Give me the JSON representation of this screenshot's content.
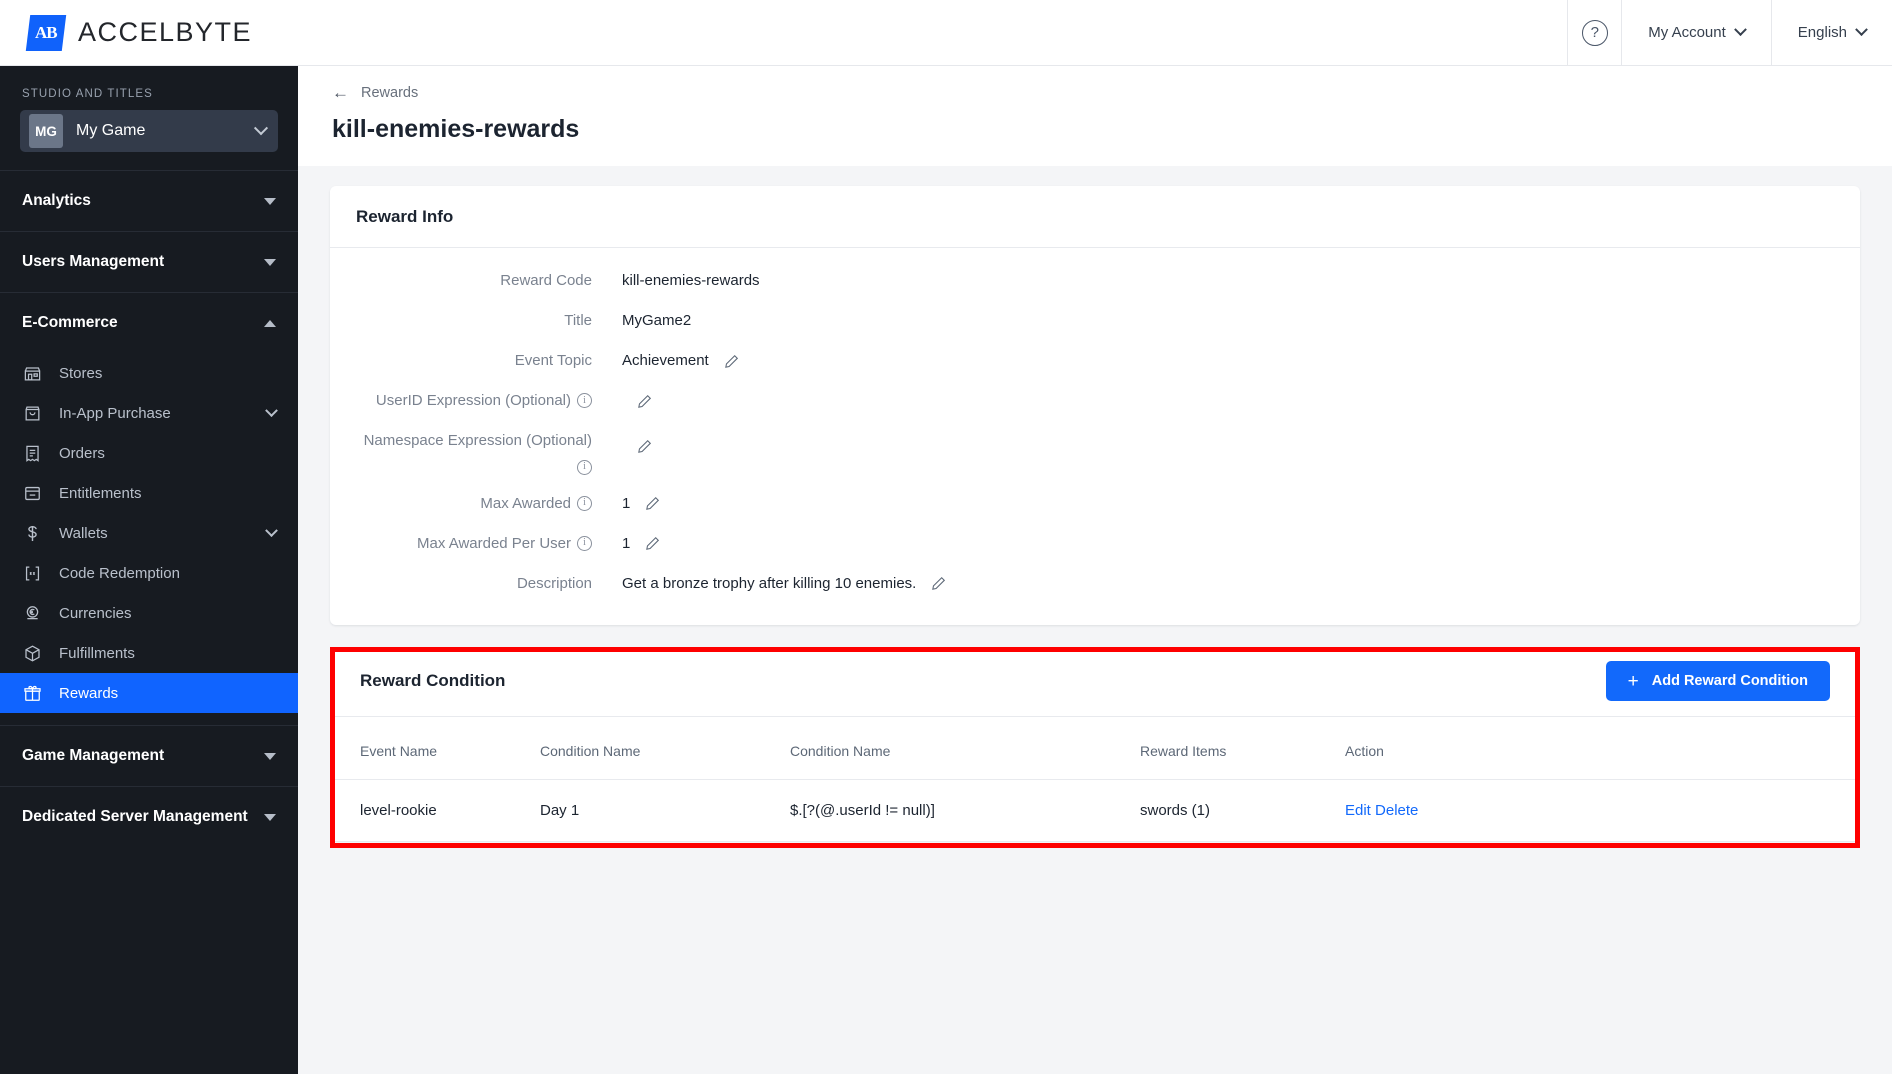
{
  "brand": {
    "mark": "AB",
    "name": "ACCELBYTE"
  },
  "topbar": {
    "help_icon": "help-circle-icon",
    "help_glyph": "?",
    "account_label": "My Account",
    "language_label": "English"
  },
  "sidebar": {
    "studio_label": "STUDIO AND TITLES",
    "game": {
      "badge": "MG",
      "name": "My Game"
    },
    "groups": [
      {
        "label": "Analytics",
        "expanded": false,
        "items": []
      },
      {
        "label": "Users Management",
        "expanded": false,
        "items": []
      },
      {
        "label": "E-Commerce",
        "expanded": true,
        "items": [
          {
            "label": "Stores",
            "icon": "store-icon",
            "active": false,
            "expandable": false
          },
          {
            "label": "In-App Purchase",
            "icon": "shopping-bag-icon",
            "active": false,
            "expandable": true
          },
          {
            "label": "Orders",
            "icon": "receipt-icon",
            "active": false,
            "expandable": false
          },
          {
            "label": "Entitlements",
            "icon": "entitlement-card-icon",
            "active": false,
            "expandable": false
          },
          {
            "label": "Wallets",
            "icon": "dollar-icon",
            "active": false,
            "expandable": true
          },
          {
            "label": "Code Redemption",
            "icon": "code-bracket-icon",
            "active": false,
            "expandable": false
          },
          {
            "label": "Currencies",
            "icon": "coin-euro-icon",
            "active": false,
            "expandable": false
          },
          {
            "label": "Fulfillments",
            "icon": "box-icon",
            "active": false,
            "expandable": false
          },
          {
            "label": "Rewards",
            "icon": "gift-icon",
            "active": true,
            "expandable": false
          }
        ]
      },
      {
        "label": "Game Management",
        "expanded": false,
        "items": []
      },
      {
        "label": "Dedicated Server Management",
        "expanded": false,
        "items": []
      }
    ]
  },
  "page": {
    "breadcrumb": "Rewards",
    "back_icon": "arrow-left-icon",
    "title": "kill-enemies-rewards"
  },
  "reward_info": {
    "card_title": "Reward Info",
    "rows": [
      {
        "label": "Reward Code",
        "value": "kill-enemies-rewards",
        "info": false,
        "edit": false
      },
      {
        "label": "Title",
        "value": "MyGame2",
        "info": false,
        "edit": false
      },
      {
        "label": "Event Topic",
        "value": "Achievement",
        "info": false,
        "edit": true
      },
      {
        "label": "UserID Expression (Optional)",
        "value": "",
        "info": true,
        "edit": true
      },
      {
        "label": "Namespace Expression (Optional)",
        "value": "",
        "info": true,
        "edit": true
      },
      {
        "label": "Max Awarded",
        "value": "1",
        "info": true,
        "edit": true
      },
      {
        "label": "Max Awarded Per User",
        "value": "1",
        "info": true,
        "edit": true
      },
      {
        "label": "Description",
        "value": "Get a bronze trophy after killing 10 enemies.",
        "info": false,
        "edit": true
      }
    ]
  },
  "reward_condition": {
    "card_title": "Reward Condition",
    "add_button": "Add Reward Condition",
    "add_icon": "plus-icon",
    "columns": [
      "Event Name",
      "Condition Name",
      "Condition Name",
      "Reward Items",
      "Action"
    ],
    "rows": [
      {
        "event_name": "level-rookie",
        "condition_name": "Day 1",
        "condition_expression": "$.[?(@.userId != null)]",
        "reward_items": "swords (1)",
        "action_edit": "Edit",
        "action_delete": "Delete"
      }
    ]
  },
  "colors": {
    "accent_blue": "#1269fb",
    "sidebar_bg": "#171b21",
    "highlight_red": "#fe0000",
    "page_bg": "#f4f5f7"
  }
}
